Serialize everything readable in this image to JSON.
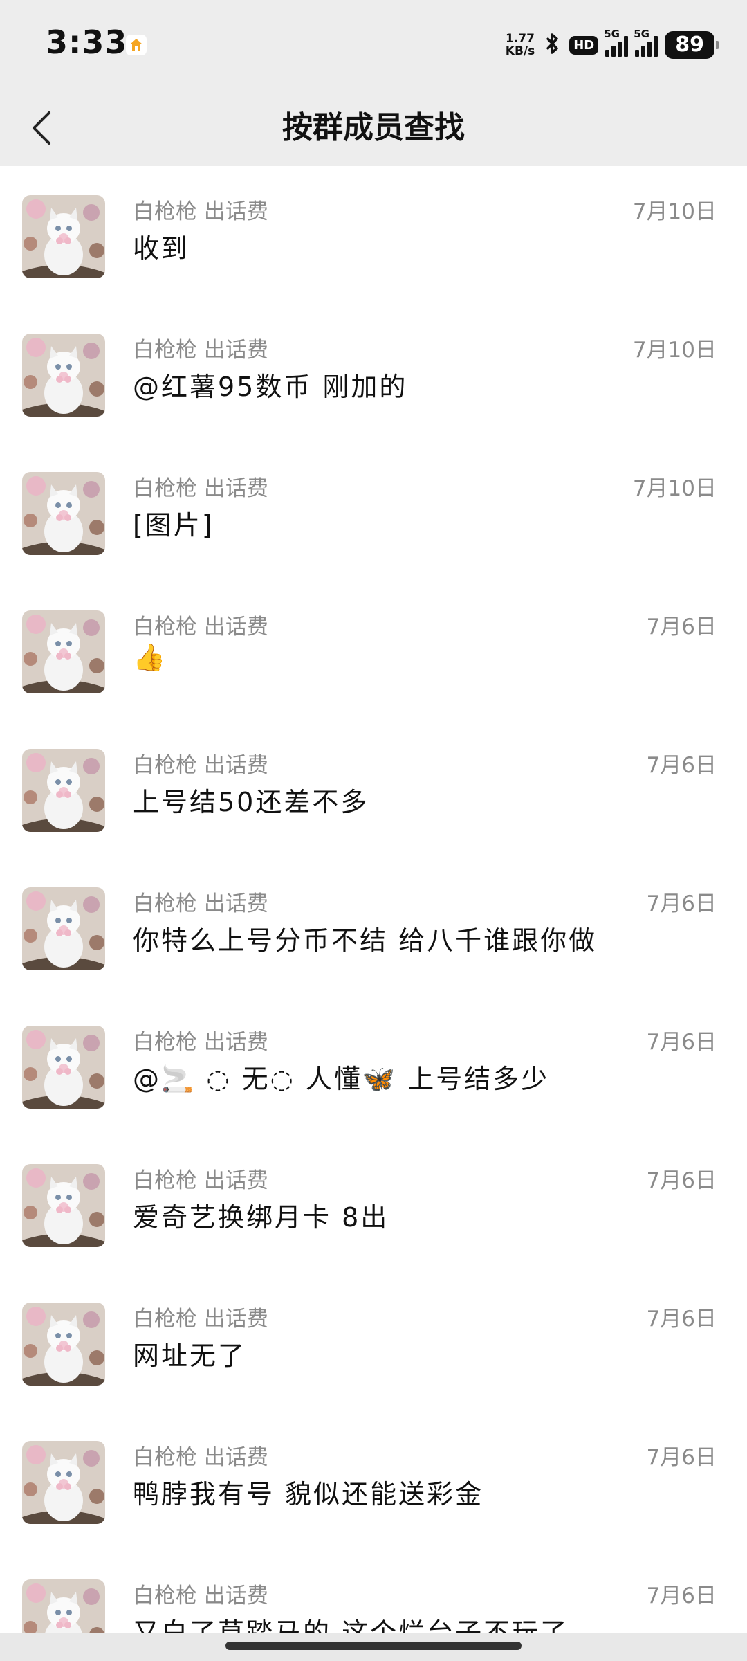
{
  "status_bar": {
    "time": "3:33",
    "net_speed_value": "1.77",
    "net_speed_unit": "KB/s",
    "hd_label": "HD",
    "sim1_label": "5G",
    "sim2_label": "5G",
    "battery": "89"
  },
  "header": {
    "title": "按群成员查找"
  },
  "messages": [
    {
      "sender": "白枪枪 出话费",
      "date": "7月10日",
      "text": "收到"
    },
    {
      "sender": "白枪枪 出话费",
      "date": "7月10日",
      "text": "@红薯95数币 刚加的"
    },
    {
      "sender": "白枪枪 出话费",
      "date": "7月10日",
      "text": "[图片]"
    },
    {
      "sender": "白枪枪 出话费",
      "date": "7月6日",
      "text": "👍"
    },
    {
      "sender": "白枪枪 出话费",
      "date": "7月6日",
      "text": "上号结50还差不多"
    },
    {
      "sender": "白枪枪 出话费",
      "date": "7月6日",
      "text": "你特么上号分币不结  给八千谁跟你做"
    },
    {
      "sender": "白枪枪 出话费",
      "date": "7月6日",
      "text": "@🚬 ◌ 无◌ 人懂🦋  上号结多少"
    },
    {
      "sender": "白枪枪 出话费",
      "date": "7月6日",
      "text": "爱奇艺换绑月卡  8出"
    },
    {
      "sender": "白枪枪 出话费",
      "date": "7月6日",
      "text": "网址无了"
    },
    {
      "sender": "白枪枪 出话费",
      "date": "7月6日",
      "text": "鸭脖我有号  貌似还能送彩金"
    },
    {
      "sender": "白枪枪 出话费",
      "date": "7月6日",
      "text": "又白了草踏马的  这个烂台子不玩了"
    }
  ]
}
